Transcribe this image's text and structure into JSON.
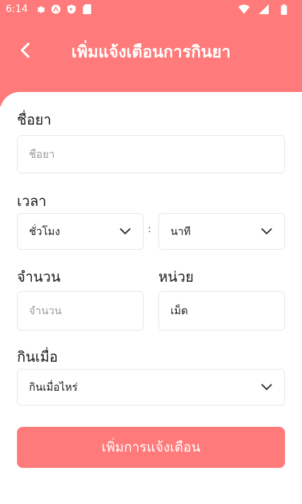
{
  "status_bar": {
    "time": "6:14"
  },
  "header": {
    "title": "เพิ่มแจ้งเตือนการกินยา"
  },
  "form": {
    "drug_name": {
      "label": "ชื่อยา",
      "placeholder": "ชื่อยา",
      "value": ""
    },
    "time": {
      "label": "เวลา",
      "hour_value": "ชั่วโมง",
      "separator": ":",
      "minute_value": "นาที"
    },
    "amount": {
      "label": "จำนวน",
      "placeholder": "จำนวน",
      "value": ""
    },
    "unit": {
      "label": "หน่วย",
      "value": "เม็ด"
    },
    "take_when": {
      "label": "กินเมื่อ",
      "value": "กินเมื่อไหร่"
    }
  },
  "submit_label": "เพิ่มการแจ้งเตือน",
  "colors": {
    "accent": "#ff7a7a",
    "border": "#e7e7e7",
    "placeholder": "#9a9a9a"
  },
  "icons": [
    "gear-icon",
    "app-a-icon",
    "shield-icon",
    "sim-icon",
    "wifi-icon",
    "signal-icon",
    "battery-icon",
    "back-arrow-icon",
    "chevron-down-icon"
  ]
}
